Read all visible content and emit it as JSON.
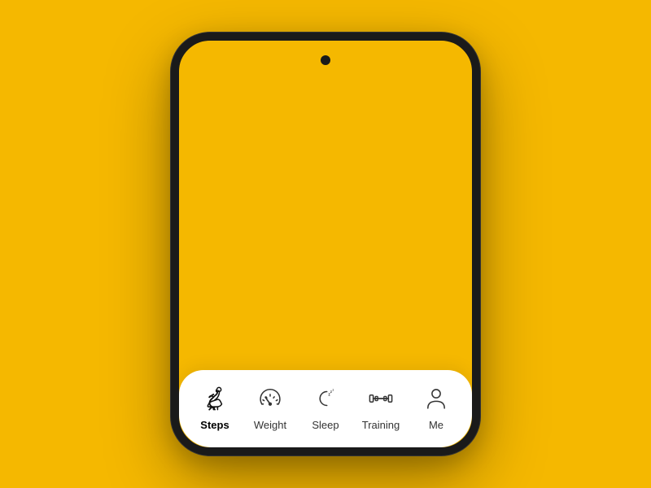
{
  "background_color": "#F5B800",
  "nav": {
    "items": [
      {
        "id": "steps",
        "label": "Steps",
        "active": true
      },
      {
        "id": "weight",
        "label": "Weight",
        "active": false
      },
      {
        "id": "sleep",
        "label": "Sleep",
        "active": false
      },
      {
        "id": "training",
        "label": "Training",
        "active": false
      },
      {
        "id": "me",
        "label": "Me",
        "active": false
      }
    ]
  }
}
